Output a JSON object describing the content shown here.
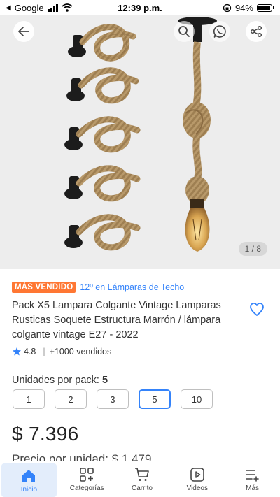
{
  "status_bar": {
    "back_app": "Google",
    "time": "12:39 p.m.",
    "battery": "94%"
  },
  "gallery": {
    "counter": "1 / 8",
    "icons": [
      "back-arrow-icon",
      "search-icon",
      "whatsapp-icon",
      "share-icon"
    ]
  },
  "product": {
    "badge": "MÁS VENDIDO",
    "rank": "12º en Lámparas de Techo",
    "title": "Pack X5 Lampara Colgante Vintage Lamparas Rusticas Soquete Estructura Marrón / lámpara colgante vintage E27 - 2022",
    "rating": "4.8",
    "sold": "+1000 vendidos"
  },
  "units": {
    "label": "Unidades por pack:",
    "selected": "5",
    "options": [
      "1",
      "2",
      "3",
      "5",
      "10"
    ]
  },
  "pricing": {
    "price": "$ 7.396",
    "unit_price": "Precio por unidad: $ 1.479"
  },
  "nav": {
    "items": [
      "Inicio",
      "Categorías",
      "Carrito",
      "Videos",
      "Más"
    ],
    "active": "Inicio"
  },
  "colors": {
    "accent": "#3483fa",
    "badge": "#ff7733"
  }
}
